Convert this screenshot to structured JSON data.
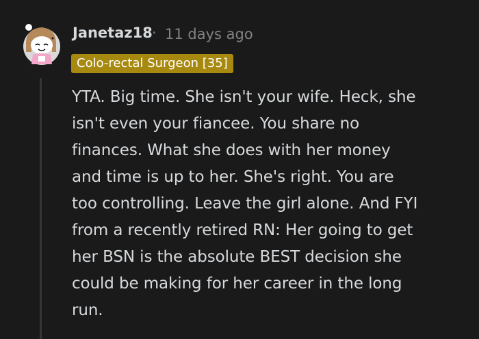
{
  "comment": {
    "author": "Janetaz18",
    "separator": "·",
    "timestamp": "11 days ago",
    "flair": "Colo-rectal Surgeon [35]",
    "flair_color": "#a8890f",
    "avatar_icon": "snoo-avatar-icon",
    "body_lines": [
      "YTA. Big time. She isn't your wife. Heck, she",
      "isn't even your fiancee. You share no",
      "finances. What she does with her money",
      "and time is up to her. She's right. You are",
      "too controlling. Leave the girl alone. And FYI",
      "from a recently retired RN: Her going to get",
      "her BSN is the absolute BEST decision she",
      "could be making for her career in the long",
      "run."
    ]
  },
  "colors": {
    "background": "#1a1a1b",
    "text": "#d7dadc",
    "meta": "#818384",
    "thread_line": "#343536"
  }
}
